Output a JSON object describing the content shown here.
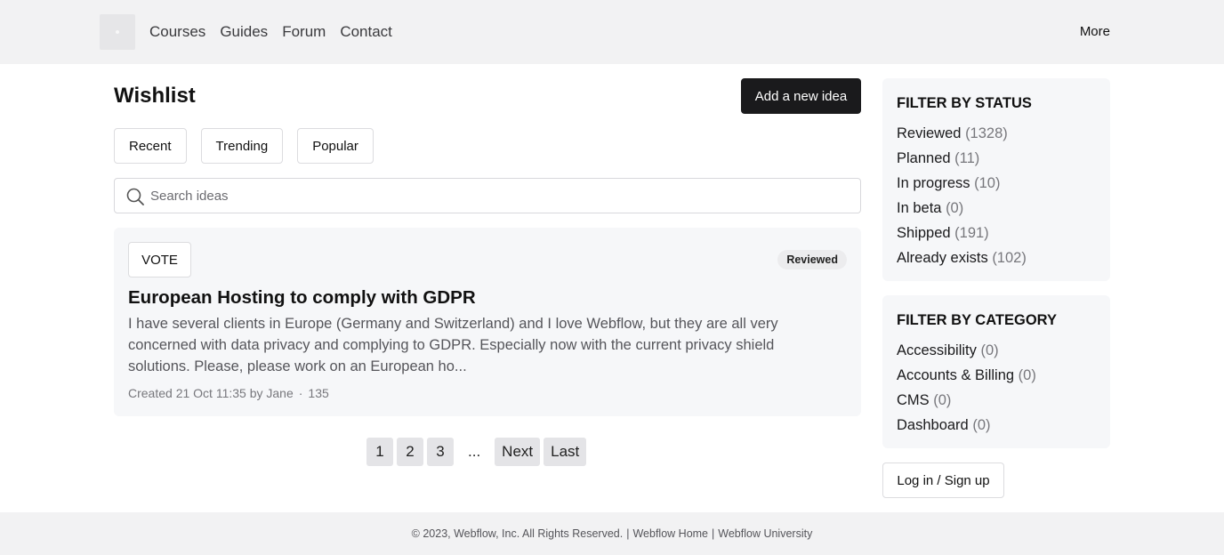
{
  "nav": {
    "items": [
      "Courses",
      "Guides",
      "Forum",
      "Contact"
    ],
    "more_label": "More"
  },
  "main": {
    "title": "Wishlist",
    "add_button": "Add a new idea",
    "sort_tabs": [
      "Recent",
      "Trending",
      "Popular"
    ],
    "search_placeholder": "Search ideas"
  },
  "idea": {
    "vote_label": "VOTE",
    "status": "Reviewed",
    "title": "European Hosting to comply with GDPR",
    "body": "I have several clients in Europe (Germany and Switzerland) and I love Webflow, but they are all very concerned with data privacy and complying to GDPR. Especially now with the current privacy shield solutions. Please, please work on an European ho...",
    "meta_created": "Created 21 Oct 11:35 by Jane",
    "meta_sep": "·",
    "meta_votes": "135"
  },
  "pagination": {
    "pages": [
      "1",
      "2",
      "3"
    ],
    "ellipsis": "...",
    "next": "Next",
    "last": "Last"
  },
  "sidebar": {
    "status_title": "FILTER BY STATUS",
    "statuses": [
      {
        "label": "Reviewed",
        "count": "(1328)"
      },
      {
        "label": "Planned",
        "count": "(11)"
      },
      {
        "label": "In progress",
        "count": "(10)"
      },
      {
        "label": "In beta",
        "count": "(0)"
      },
      {
        "label": "Shipped",
        "count": "(191)"
      },
      {
        "label": "Already exists",
        "count": "(102)"
      }
    ],
    "category_title": "FILTER BY CATEGORY",
    "categories": [
      {
        "label": "Accessibility",
        "count": "(0)"
      },
      {
        "label": "Accounts & Billing",
        "count": "(0)"
      },
      {
        "label": "CMS",
        "count": "(0)"
      },
      {
        "label": "Dashboard",
        "count": "(0)"
      }
    ],
    "login_label": "Log in / Sign up"
  },
  "footer": {
    "copyright": "© 2023, Webflow, Inc. All Rights Reserved.",
    "sep": "|",
    "link_home": "Webflow Home",
    "link_university": "Webflow University"
  },
  "icons": {
    "search": "search-icon",
    "logo": "logo-placeholder"
  },
  "colors": {
    "primary_button": "#1a1a1c",
    "header_bg": "#f2f2f3",
    "card_bg": "#f6f7f9"
  }
}
